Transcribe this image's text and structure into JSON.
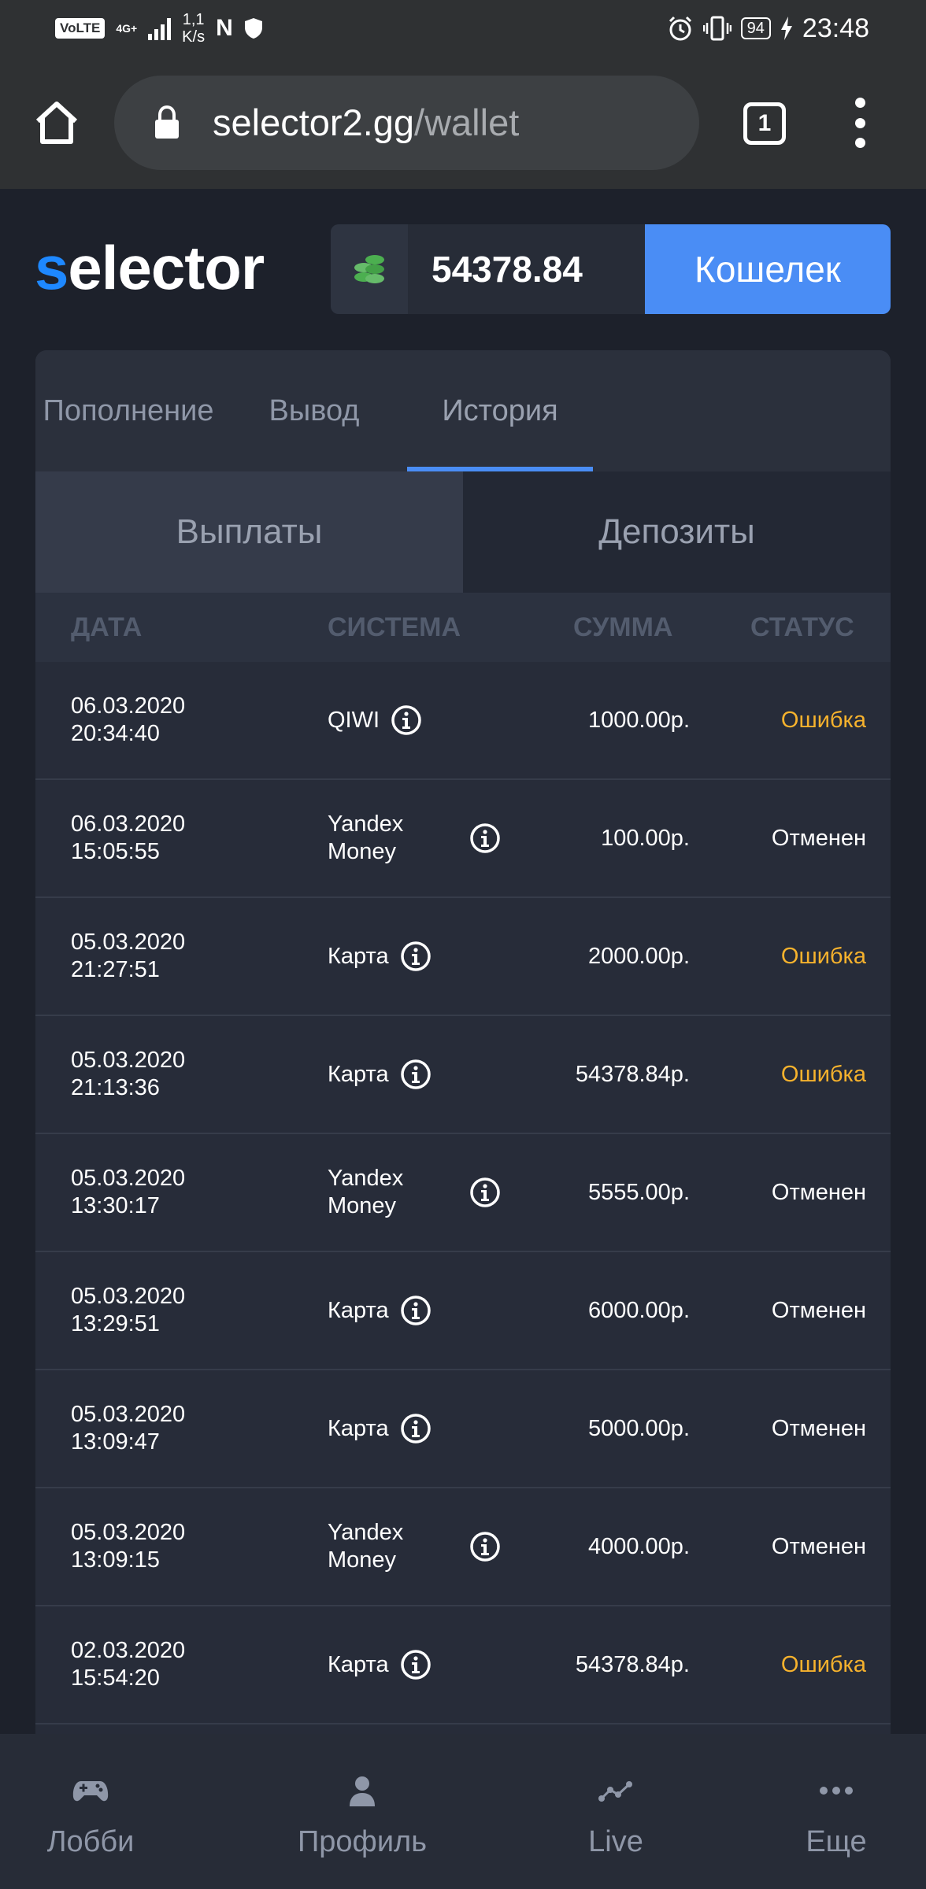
{
  "status_bar": {
    "volte": "VoLTE",
    "network": "4G+",
    "speed_value": "1,1",
    "speed_unit": "K/s",
    "nfc": "N",
    "battery": "94",
    "time": "23:48",
    "icons": [
      "signal-bars-icon",
      "nfc-icon",
      "shield-icon",
      "alarm-icon",
      "vibrate-icon",
      "battery-icon",
      "charging-icon"
    ]
  },
  "browser": {
    "url_host": "selector2.gg",
    "url_path": "/wallet",
    "tab_count": "1",
    "icons": [
      "home-icon",
      "lock-icon",
      "tabs-icon",
      "more-vert-icon"
    ]
  },
  "header": {
    "logo_first": "s",
    "logo_rest": "elector",
    "balance": "54378.84",
    "wallet_button": "Кошелек",
    "coin_icon": "coin-stack-icon"
  },
  "colors": {
    "accent": "#4a8df5",
    "logo_accent": "#1e88ff",
    "error": "#f6b22d",
    "coin": "#4caf50"
  },
  "tabs": [
    {
      "label": "Пополнение",
      "active": false
    },
    {
      "label": "Вывод",
      "active": false
    },
    {
      "label": "История",
      "active": true
    }
  ],
  "subtabs": [
    {
      "label": "Выплаты",
      "active": true
    },
    {
      "label": "Депозиты",
      "active": false
    }
  ],
  "table": {
    "columns": [
      "ДАТА",
      "СИСТЕМА",
      "СУММА",
      "СТАТУС"
    ],
    "rows": [
      {
        "date": "06.03.2020",
        "time": "20:34:40",
        "system": [
          "QIWI"
        ],
        "sum": "1000.00р.",
        "status": "Ошибка",
        "status_type": "error"
      },
      {
        "date": "06.03.2020",
        "time": "15:05:55",
        "system": [
          "Yandex",
          "Money"
        ],
        "sum": "100.00р.",
        "status": "Отменен",
        "status_type": "cancel"
      },
      {
        "date": "05.03.2020",
        "time": "21:27:51",
        "system": [
          "Карта"
        ],
        "sum": "2000.00р.",
        "status": "Ошибка",
        "status_type": "error"
      },
      {
        "date": "05.03.2020",
        "time": "21:13:36",
        "system": [
          "Карта"
        ],
        "sum": "54378.84р.",
        "status": "Ошибка",
        "status_type": "error"
      },
      {
        "date": "05.03.2020",
        "time": "13:30:17",
        "system": [
          "Yandex",
          "Money"
        ],
        "sum": "5555.00р.",
        "status": "Отменен",
        "status_type": "cancel"
      },
      {
        "date": "05.03.2020",
        "time": "13:29:51",
        "system": [
          "Карта"
        ],
        "sum": "6000.00р.",
        "status": "Отменен",
        "status_type": "cancel"
      },
      {
        "date": "05.03.2020",
        "time": "13:09:47",
        "system": [
          "Карта"
        ],
        "sum": "5000.00р.",
        "status": "Отменен",
        "status_type": "cancel"
      },
      {
        "date": "05.03.2020",
        "time": "13:09:15",
        "system": [
          "Yandex",
          "Money"
        ],
        "sum": "4000.00р.",
        "status": "Отменен",
        "status_type": "cancel"
      },
      {
        "date": "02.03.2020",
        "time": "15:54:20",
        "system": [
          "Карта"
        ],
        "sum": "54378.84р.",
        "status": "Ошибка",
        "status_type": "error"
      }
    ]
  },
  "bottom_nav": [
    {
      "label": "Лобби",
      "icon": "gamepad-icon"
    },
    {
      "label": "Профиль",
      "icon": "user-icon"
    },
    {
      "label": "Live",
      "icon": "live-chart-icon"
    },
    {
      "label": "Еще",
      "icon": "more-horiz-icon"
    }
  ]
}
